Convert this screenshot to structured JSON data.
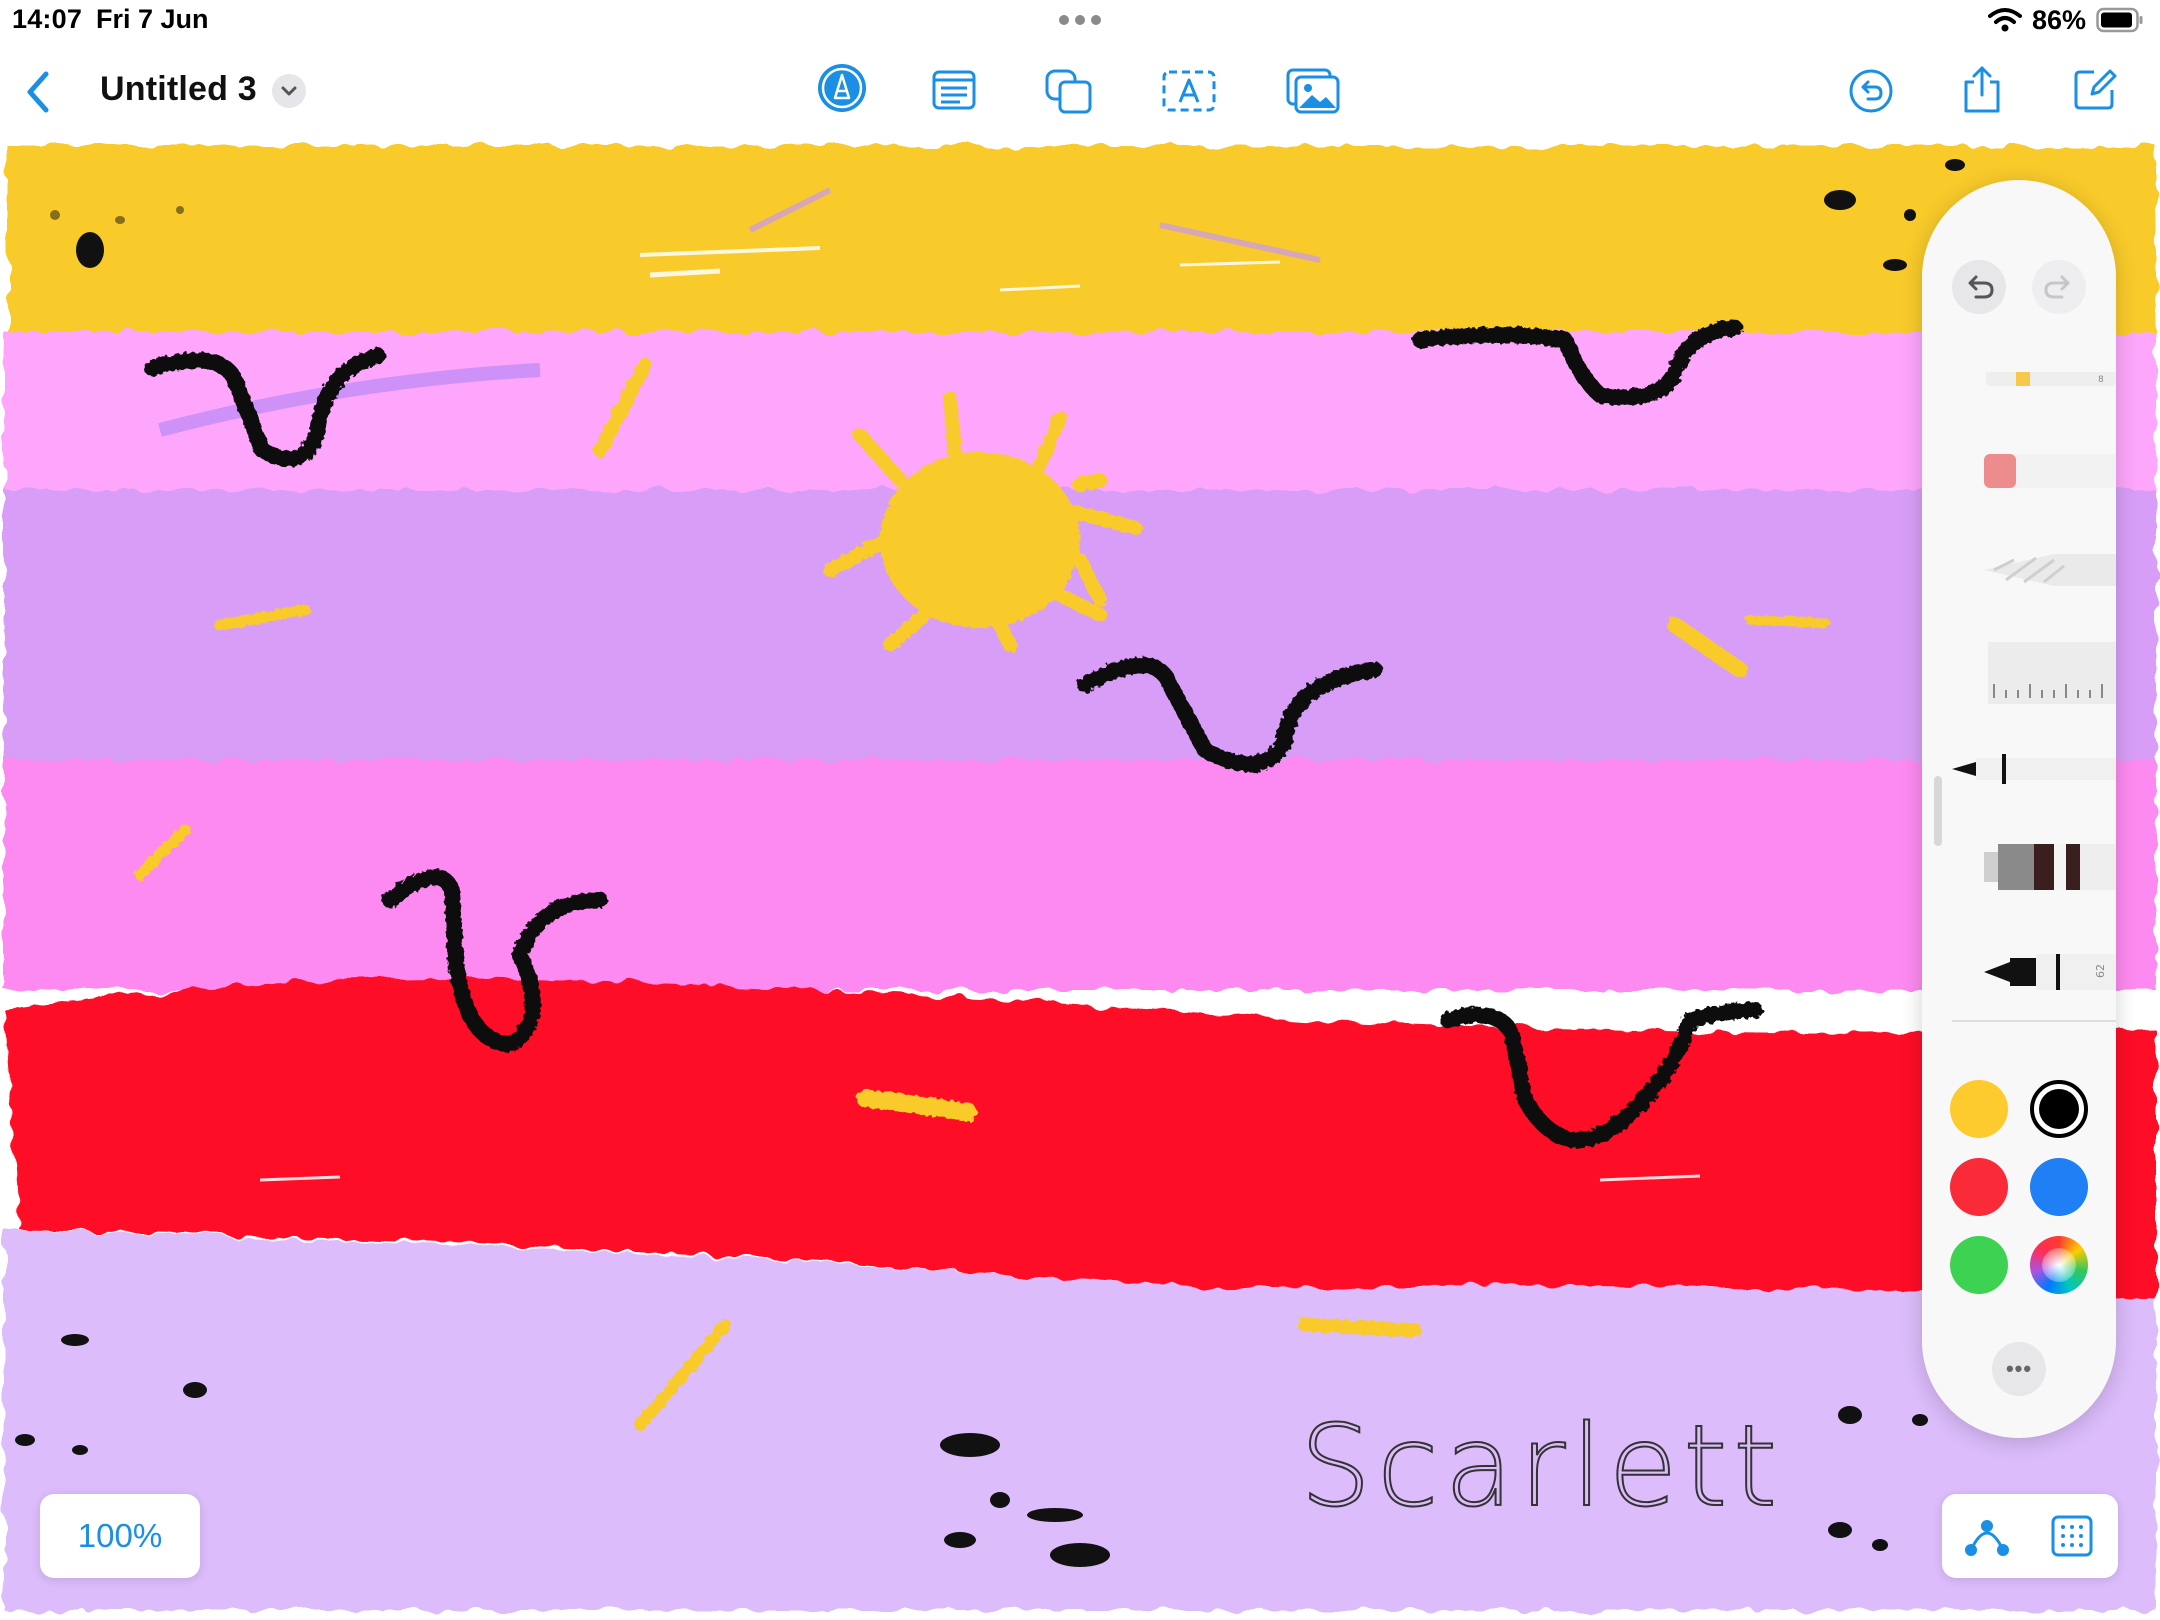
{
  "status_bar": {
    "time": "14:07",
    "date": "Fri 7 Jun",
    "battery_percent": "86%"
  },
  "toolbar": {
    "document_title": "Untitled 3",
    "icons": [
      "back-chevron-icon",
      "title-menu-chevron-icon",
      "pen-tool-icon",
      "text-box-icon",
      "shapes-icon",
      "text-field-icon",
      "media-icon",
      "undo-history-icon",
      "share-icon",
      "new-note-icon"
    ]
  },
  "canvas": {
    "band_colors": [
      "#f8ca2c",
      "#fda6fb",
      "#d89ef7",
      "#fd8af0",
      "#fe0b26",
      "#dcbcfb"
    ],
    "handwriting": "Scarlett"
  },
  "palette": {
    "tools": [
      "undo-icon",
      "redo-icon",
      "highlighter-tool",
      "eraser-tool",
      "lasso-tool",
      "ruler-tool",
      "pen-tool",
      "marker-tool",
      "fineliner-tool"
    ],
    "tool_numbers": {
      "fineliner": "62",
      "highlighter": "8"
    },
    "swatches": [
      "#fecb2f",
      "#000000",
      "#fa2b39",
      "#1f7ff4",
      "#3ed252",
      "color-wheel"
    ],
    "selected_swatch": "#000000",
    "more_label": "•••"
  },
  "bottom": {
    "zoom": "100%",
    "icons": [
      "connector-icon",
      "grid-icon"
    ]
  }
}
